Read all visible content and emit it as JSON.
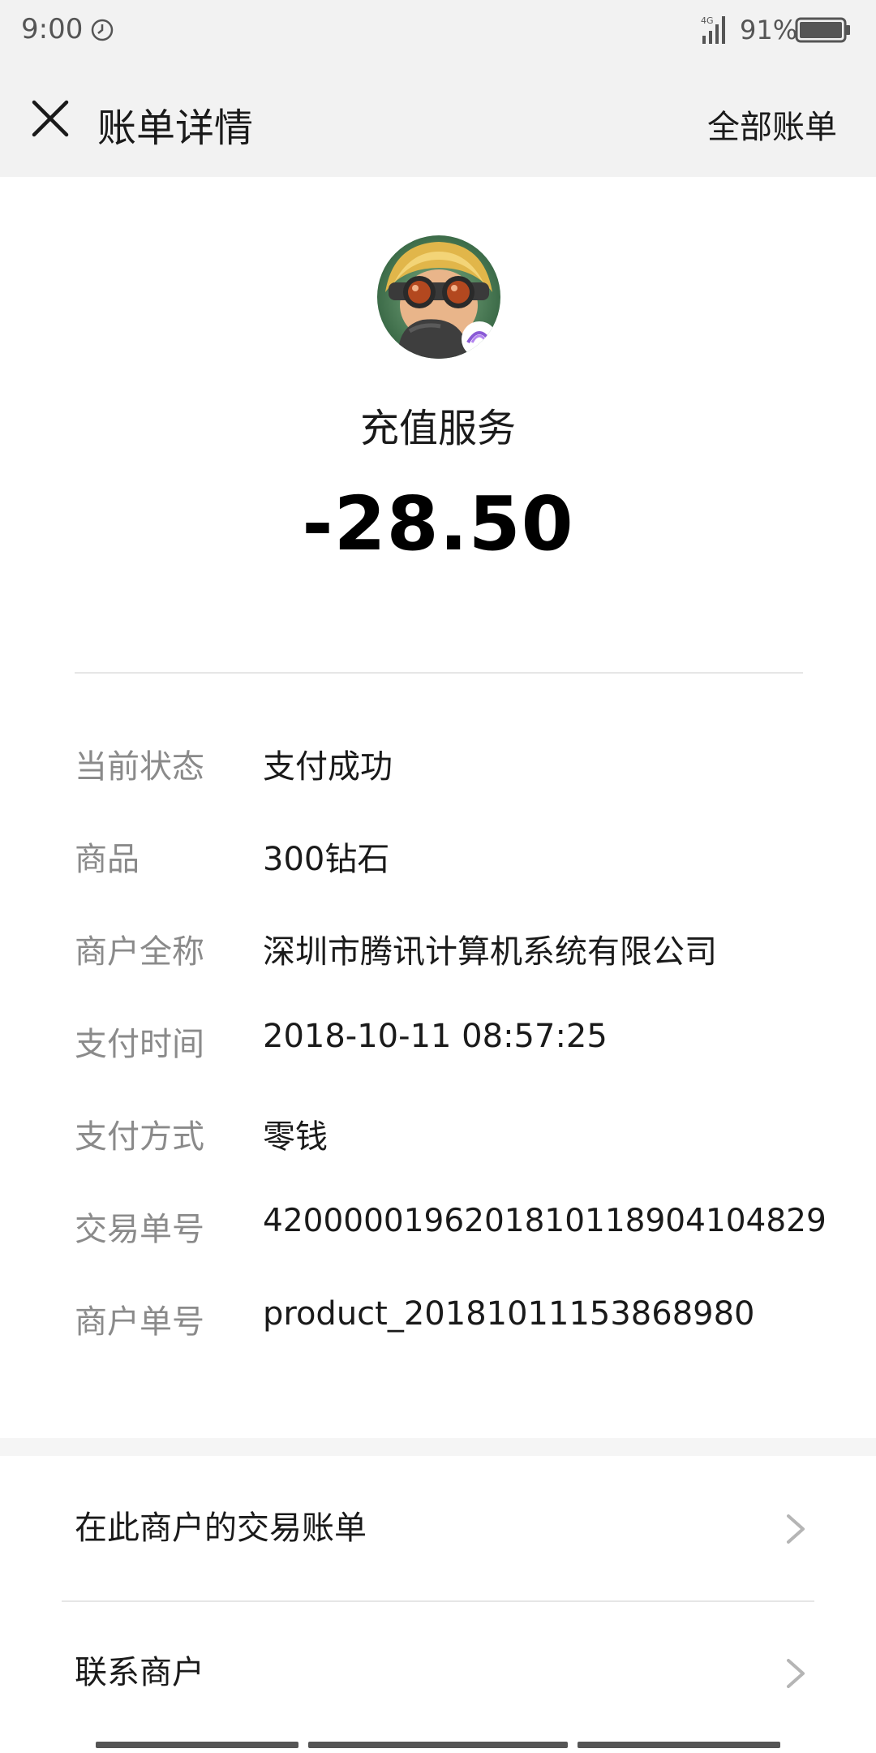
{
  "status_bar": {
    "time": "9:00",
    "network": "4G",
    "battery": "91%"
  },
  "header": {
    "title": "账单详情",
    "all_bills": "全部账单"
  },
  "transaction": {
    "merchant_name": "充值服务",
    "amount": "-28.50"
  },
  "details": [
    {
      "label": "当前状态",
      "value": "支付成功"
    },
    {
      "label": "商品",
      "value": "300钻石"
    },
    {
      "label": "商户全称",
      "value": "深圳市腾讯计算机系统有限公司"
    },
    {
      "label": "支付时间",
      "value": "2018-10-11 08:57:25"
    },
    {
      "label": "支付方式",
      "value": "零钱"
    },
    {
      "label": "交易单号",
      "value": "4200000196201810118904104829"
    },
    {
      "label": "商户单号",
      "value": "product_20181011153868980"
    }
  ],
  "actions": [
    {
      "label": "在此商户的交易账单"
    },
    {
      "label": "联系商户"
    }
  ],
  "icons": {
    "close": "close-icon",
    "alarm": "alarm-icon",
    "signal": "signal-icon",
    "battery": "battery-icon",
    "chevron": "chevron-right-icon"
  }
}
